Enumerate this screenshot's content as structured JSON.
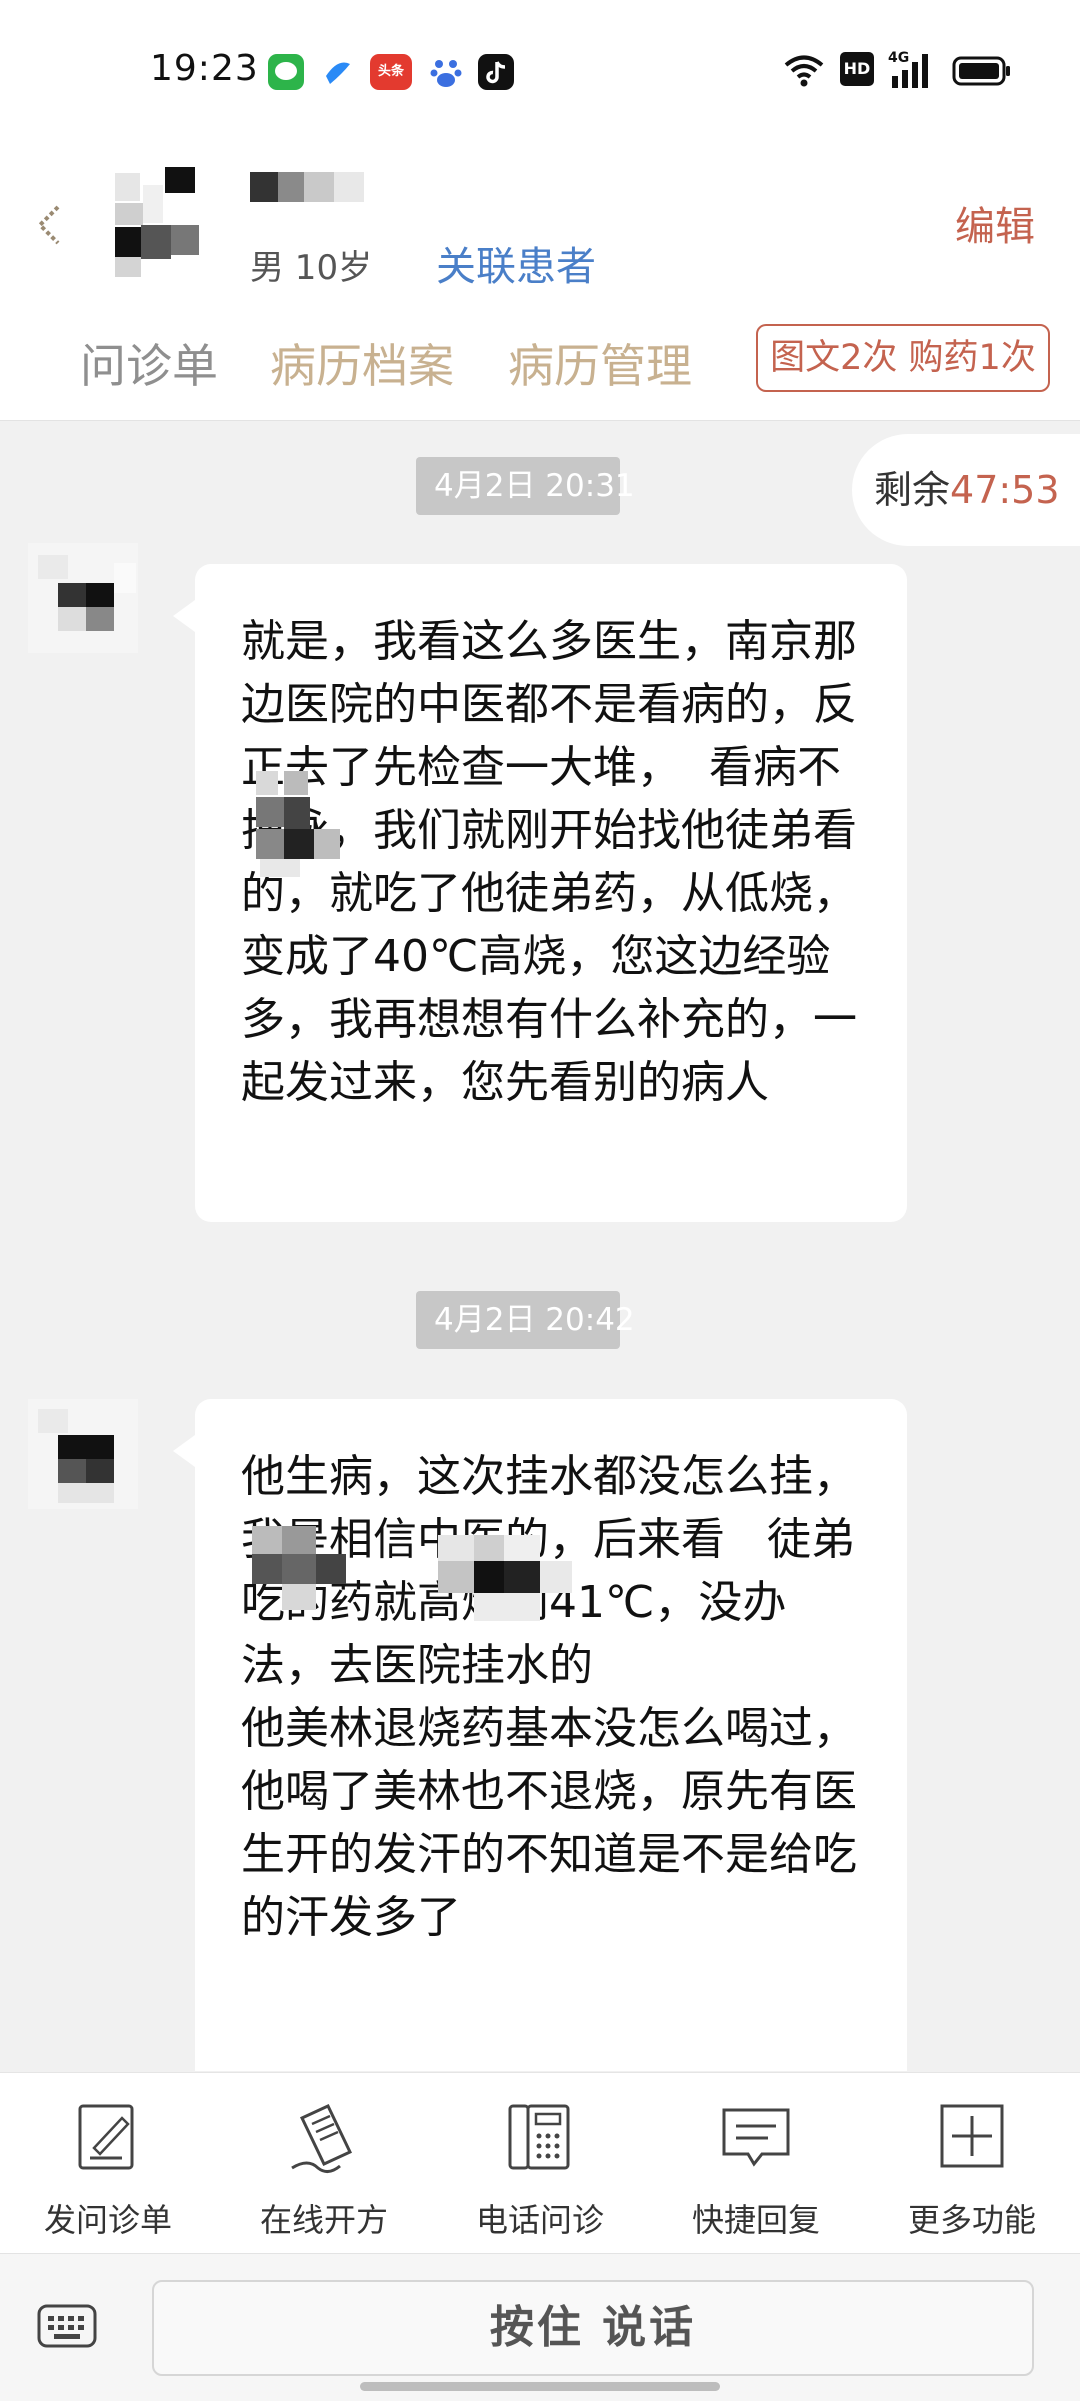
{
  "status_bar": {
    "time": "19:23",
    "apps": [
      {
        "icon": "wechat-icon",
        "color": "#2db44a"
      },
      {
        "icon": "browser-icon",
        "color": "#2a8af6"
      },
      {
        "icon": "toutiao-icon",
        "color": "#e33a2f",
        "text": "头条"
      },
      {
        "icon": "baidu-icon",
        "color": "#3b6fe0"
      },
      {
        "icon": "tiktok-icon",
        "color": "#111111"
      }
    ],
    "hd_label": "HD",
    "network_label": "4G"
  },
  "header": {
    "patient_info": "男 10岁",
    "link_patient": "关联患者",
    "edit": "编辑",
    "tabs": [
      "问诊单",
      "病历档案",
      "病历管理"
    ],
    "usage_badge": "图文2次 购药1次"
  },
  "chat": {
    "remaining_label": "剩余",
    "remaining_time": "47:53",
    "messages": [
      {
        "timestamp": "4月2日 20:31",
        "text": "就是，我看这么多医生，南京那边医院的中医都不是看病的，反正去了先检查一大堆，  看病不把脉，我们就刚开始找他徒弟看的，就吃了他徒弟药，从低烧，变成了40℃高烧，您这边经验多，我再想想有什么补充的，一起发过来，您先看别的病人"
      },
      {
        "timestamp": "4月2日 20:42",
        "text": "他生病，这次挂水都没怎么挂，我是相信中医的，后来看   徒弟     吃的药就高烧到41℃，没办法，去医院挂水的\n他美林退烧药基本没怎么喝过，他喝了美林也不退烧，原先有医生开的发汗的不知道是不是给吃的汗发多了"
      }
    ]
  },
  "toolbar": {
    "items": [
      {
        "label": "发问诊单",
        "icon": "form-edit-icon"
      },
      {
        "label": "在线开方",
        "icon": "prescription-icon"
      },
      {
        "label": "电话问诊",
        "icon": "phone-icon"
      },
      {
        "label": "快捷回复",
        "icon": "quick-reply-icon"
      },
      {
        "label": "更多功能",
        "icon": "plus-icon"
      }
    ]
  },
  "input_bar": {
    "talk_button": "按住 说话"
  }
}
